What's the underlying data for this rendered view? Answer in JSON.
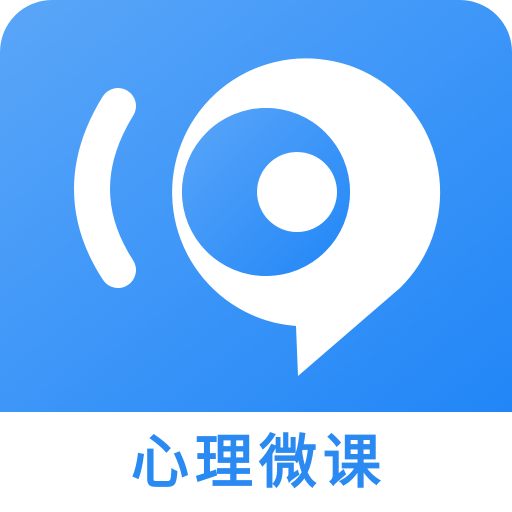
{
  "app": {
    "name": "心理微课",
    "logo_icon": "speech-bubble-sound-icon"
  },
  "colors": {
    "gradient_start": "#5aa6f8",
    "gradient_end": "#2186f7",
    "glyph": "#ffffff",
    "label": "#2a8af2",
    "background": "#ffffff"
  }
}
